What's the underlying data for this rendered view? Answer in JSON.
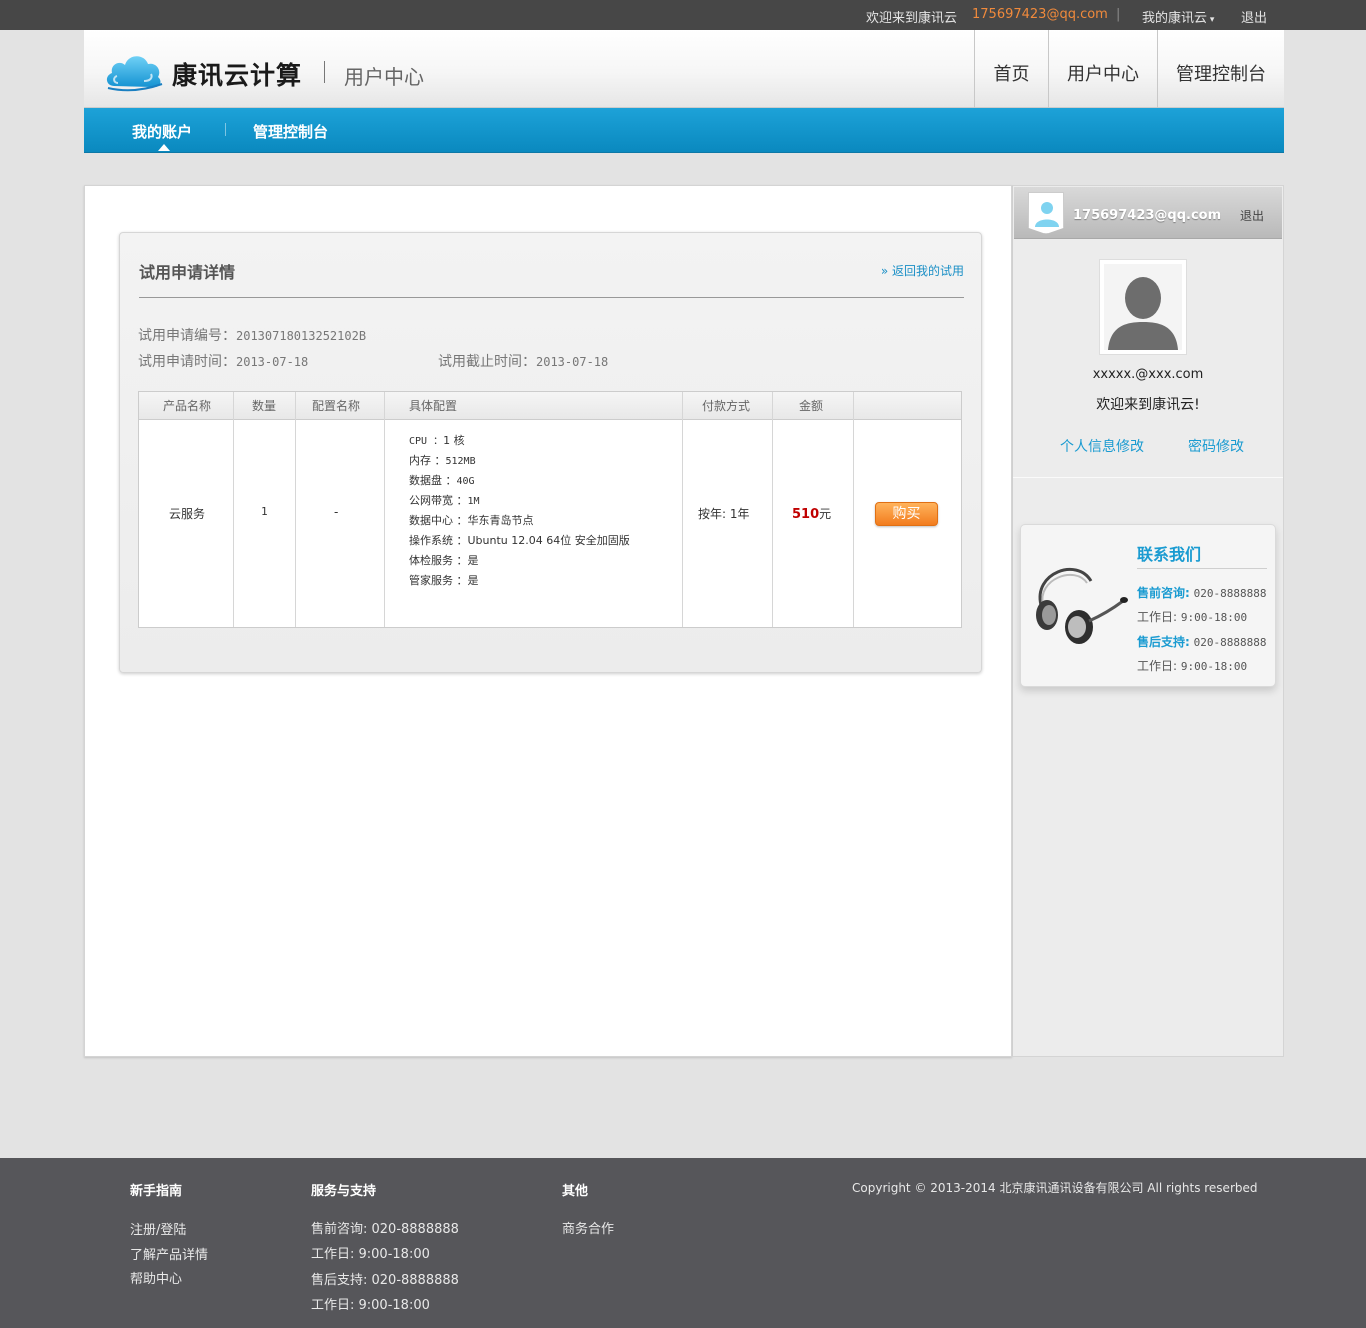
{
  "topbar": {
    "welcome": "欢迎来到康讯云",
    "email": "175697423@qq.com",
    "separator": "|",
    "my_account": "我的康讯云",
    "logout": "退出"
  },
  "header": {
    "brand": "康讯云计算",
    "sub_brand": "用户中心",
    "nav": [
      "首页",
      "用户中心",
      "管理控制台"
    ]
  },
  "subnav": {
    "items": [
      "我的账户",
      "管理控制台"
    ]
  },
  "panel": {
    "title": "试用申请详情",
    "back_link": "返回我的试用",
    "apply_no_label": "试用申请编号：",
    "apply_no": "20130718013252102B",
    "apply_time_label": "试用申请时间：",
    "apply_time": "2013-07-18",
    "deadline_label": "试用截止时间：",
    "deadline": "2013-07-18"
  },
  "table": {
    "headers": [
      "产品名称",
      "数量",
      "配置名称",
      "具体配置",
      "付款方式",
      "金额",
      ""
    ],
    "row": {
      "product": "云服务",
      "quantity": "1",
      "config_name": "-",
      "config": [
        {
          "label": "CPU ：",
          "value": "1 核"
        },
        {
          "label": "内存 ：",
          "value": "512MB"
        },
        {
          "label": "数据盘 ：",
          "value": "40G"
        },
        {
          "label": "公网带宽 ：",
          "value": "1M"
        },
        {
          "label": "数据中心 ：",
          "value": "华东青岛节点"
        },
        {
          "label": "操作系统 ：",
          "value": "Ubuntu 12.04 64位 安全加固版"
        },
        {
          "label": "体检服务 ：",
          "value": "是"
        },
        {
          "label": "管家服务 ：",
          "value": "是"
        }
      ],
      "payment": "按年: 1年",
      "amount": "510",
      "amount_unit": "元",
      "buy_label": "购买"
    }
  },
  "sidebar": {
    "email": "175697423@qq.com",
    "logout": "退出",
    "user_email": "xxxxx.@xxx.com",
    "welcome": "欢迎来到康讯云!",
    "edit_profile": "个人信息修改",
    "edit_password": "密码修改",
    "contact": {
      "title": "联系我们",
      "presale_label": "售前咨询:",
      "presale_phone": "020-8888888",
      "hours_label_1": "工作日:",
      "hours_1": "9:00-18:00",
      "support_label": "售后支持:",
      "support_phone": "020-8888888",
      "hours_label_2": "工作日:",
      "hours_2": "9:00-18:00"
    }
  },
  "footer": {
    "col1": {
      "title": "新手指南",
      "items": [
        "注册/登陆",
        "了解产品详情",
        "帮助中心"
      ]
    },
    "col2": {
      "title": "服务与支持",
      "items": [
        "售前咨询: 020-8888888",
        "工作日: 9:00-18:00",
        "售后支持: 020-8888888",
        "工作日: 9:00-18:00"
      ]
    },
    "col3": {
      "title": "其他",
      "items": [
        "商务合作"
      ]
    },
    "copyright": "Copyright © 2013-2014  北京康讯通讯设备有限公司   All rights reserbed"
  },
  "colors": {
    "accent_blue": "#1a9bd1",
    "nav_blue": "#0a89bf",
    "email_orange": "#f08a3c",
    "buy_orange": "#f27c1e",
    "amount_red": "#c00000"
  }
}
